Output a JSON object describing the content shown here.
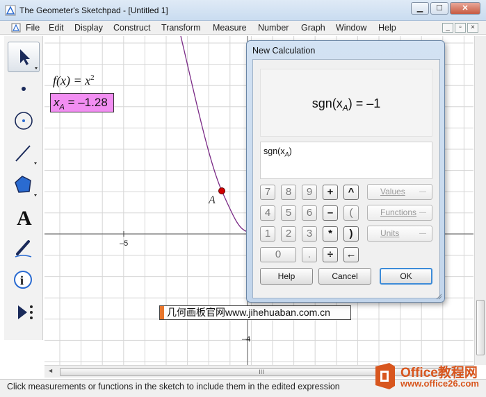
{
  "window": {
    "title": "The Geometer's Sketchpad - [Untitled 1]",
    "minimize": "▁",
    "maximize": "☐",
    "close": "✕"
  },
  "menu": {
    "items": [
      "File",
      "Edit",
      "Display",
      "Construct",
      "Transform",
      "Measure",
      "Number",
      "Graph",
      "Window",
      "Help"
    ]
  },
  "toolbox": {
    "tools": [
      "arrow-select-icon",
      "point-icon",
      "compass-icon",
      "straightedge-icon",
      "polygon-icon",
      "text-icon",
      "marker-icon",
      "information-icon",
      "custom-tool-icon"
    ]
  },
  "canvas": {
    "function_label": "f(x) = x",
    "function_exponent": "2",
    "measurement": "x",
    "measurement_subscript": "A",
    "measurement_value": "= –1.28",
    "axis_labels": [
      "–5",
      "–4"
    ],
    "point_label": "A",
    "curve_color": "#7a2a86",
    "point_color": "#d00000",
    "watermark": "几何画板官网www.jihehuaban.com.cn"
  },
  "dialog": {
    "title": "New Calculation",
    "result_text": "sgn(x",
    "result_subscript": "A",
    "result_value": ") = –1",
    "expression": "sgn(x",
    "expression_subscript": "A",
    "expression_close": ")",
    "keys": [
      "7",
      "8",
      "9",
      "+",
      "^",
      "4",
      "5",
      "6",
      "–",
      "(",
      "1",
      "2",
      "3",
      "*",
      ")",
      "0",
      ".",
      "÷",
      "←"
    ],
    "values_label": "Values",
    "functions_label": "Functions",
    "units_label": "Units",
    "help_label": "Help",
    "cancel_label": "Cancel",
    "ok_label": "OK"
  },
  "status": {
    "text": "Click measurements or functions in the sketch to include them in the edited expression"
  },
  "logo": {
    "brand": "Office教程网",
    "url": "www.office26.com"
  },
  "colors": {
    "accent": "#3c8bd8",
    "measurement_bg": "#f28ef2",
    "logo": "#d8561e"
  }
}
